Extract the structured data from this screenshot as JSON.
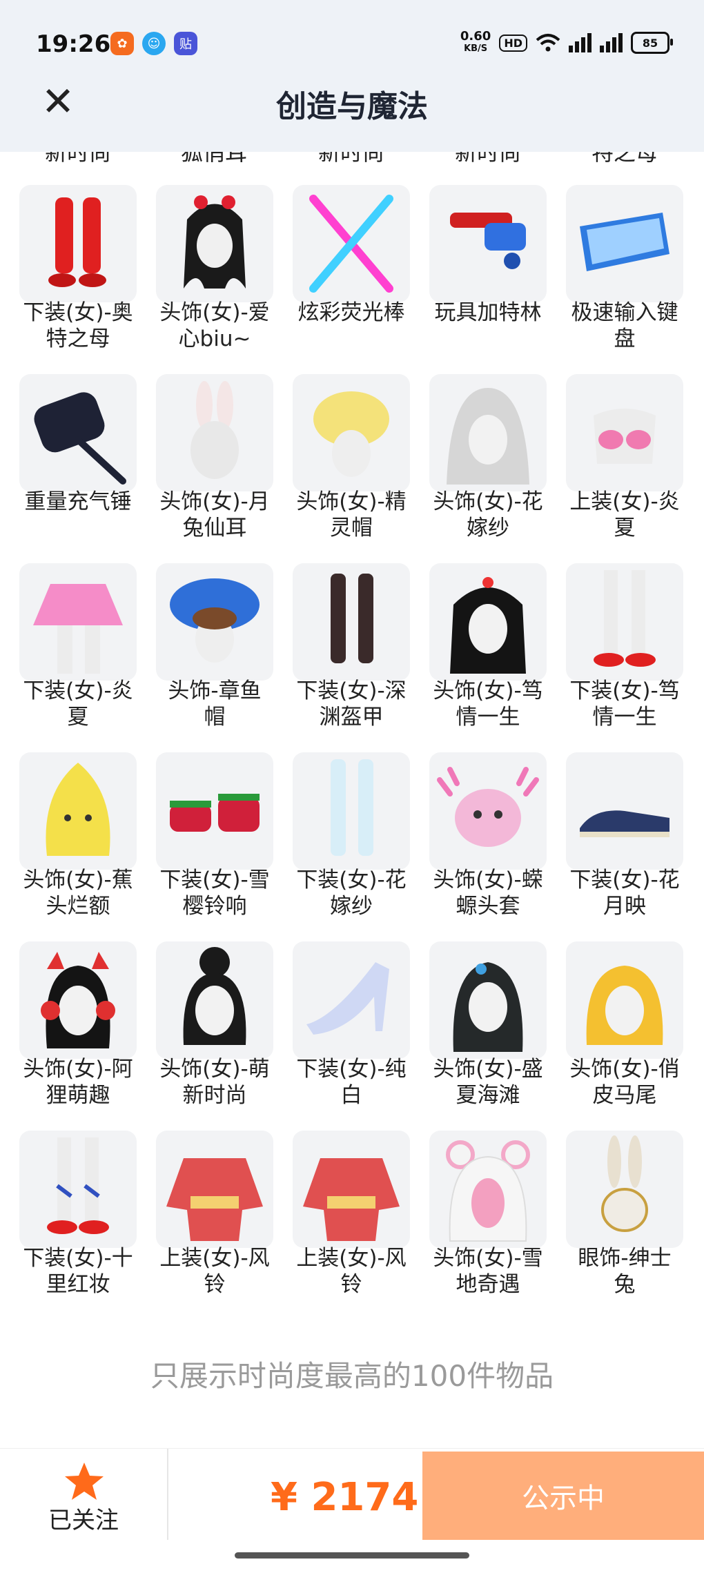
{
  "status_bar": {
    "time": "19:26",
    "apps": [
      "mi-app-icon",
      "qq-icon",
      "tieba-icon"
    ],
    "net_speed": "0.60",
    "net_unit": "KB/S",
    "hd": "HD",
    "battery": "85"
  },
  "header": {
    "title": "创造与魔法",
    "close_icon": "close-icon"
  },
  "peek_labels": [
    "新时尚",
    "狐俏耳",
    "新时尚",
    "新时尚",
    "特之母"
  ],
  "items": [
    {
      "name": "下装(女)-奥\n特之母",
      "icon": "red-boots"
    },
    {
      "name": "头饰(女)-爱\n心biu~",
      "icon": "heart-headband-hair"
    },
    {
      "name": "炫彩荧光棒",
      "icon": "glow-sticks"
    },
    {
      "name": "玩具加特林",
      "icon": "toy-gatling"
    },
    {
      "name": "极速输入键\n盘",
      "icon": "keyboard"
    },
    {
      "name": "重量充气锤",
      "icon": "inflatable-hammer"
    },
    {
      "name": "头饰(女)-月\n兔仙耳",
      "icon": "bunny-ears"
    },
    {
      "name": "头饰(女)-精\n灵帽",
      "icon": "yellow-elf-hat"
    },
    {
      "name": "头饰(女)-花\n嫁纱",
      "icon": "bridal-veil"
    },
    {
      "name": "上装(女)-炎\n夏",
      "icon": "pink-bikini-top"
    },
    {
      "name": "下装(女)-炎\n夏",
      "icon": "pink-skirt"
    },
    {
      "name": "头饰-章鱼\n帽",
      "icon": "octopus-hat"
    },
    {
      "name": "下装(女)-深\n渊盔甲",
      "icon": "dark-armor-legs"
    },
    {
      "name": "头饰(女)-笃\n情一生",
      "icon": "wedding-hair"
    },
    {
      "name": "下装(女)-笃\n情一生",
      "icon": "red-heels-legs"
    },
    {
      "name": "头饰(女)-蕉\n头烂额",
      "icon": "banana-head"
    },
    {
      "name": "下装(女)-雪\n樱铃响",
      "icon": "christmas-shoes"
    },
    {
      "name": "下装(女)-花\n嫁纱",
      "icon": "white-stockings"
    },
    {
      "name": "头饰(女)-蝾\n螈头套",
      "icon": "axolotl-hood"
    },
    {
      "name": "下装(女)-花\n月映",
      "icon": "navy-shoes"
    },
    {
      "name": "头饰(女)-阿\n狸萌趣",
      "icon": "cat-ear-headphones"
    },
    {
      "name": "头饰(女)-萌\n新时尚",
      "icon": "bun-hair"
    },
    {
      "name": "下装(女)-纯\n白",
      "icon": "crystal-heel"
    },
    {
      "name": "头饰(女)-盛\n夏海滩",
      "icon": "beach-hair"
    },
    {
      "name": "头饰(女)-俏\n皮马尾",
      "icon": "blonde-ponytail"
    },
    {
      "name": "下装(女)-十\n里红妆",
      "icon": "red-white-legs"
    },
    {
      "name": "上装(女)-风\n铃",
      "icon": "red-kimono"
    },
    {
      "name": "上装(女)-风\n铃",
      "icon": "red-kimono"
    },
    {
      "name": "头饰(女)-雪\n地奇遇",
      "icon": "bear-hood"
    },
    {
      "name": "眼饰-绅士\n兔",
      "icon": "rabbit-mask"
    }
  ],
  "footnote": "只展示时尚度最高的100件物品",
  "bottom": {
    "follow_label": "已关注",
    "price": "¥ 2174",
    "action": "公示中"
  },
  "colors": {
    "accent": "#ff6b1a",
    "button": "#ffae7b",
    "header_bg": "#eef2f7"
  }
}
